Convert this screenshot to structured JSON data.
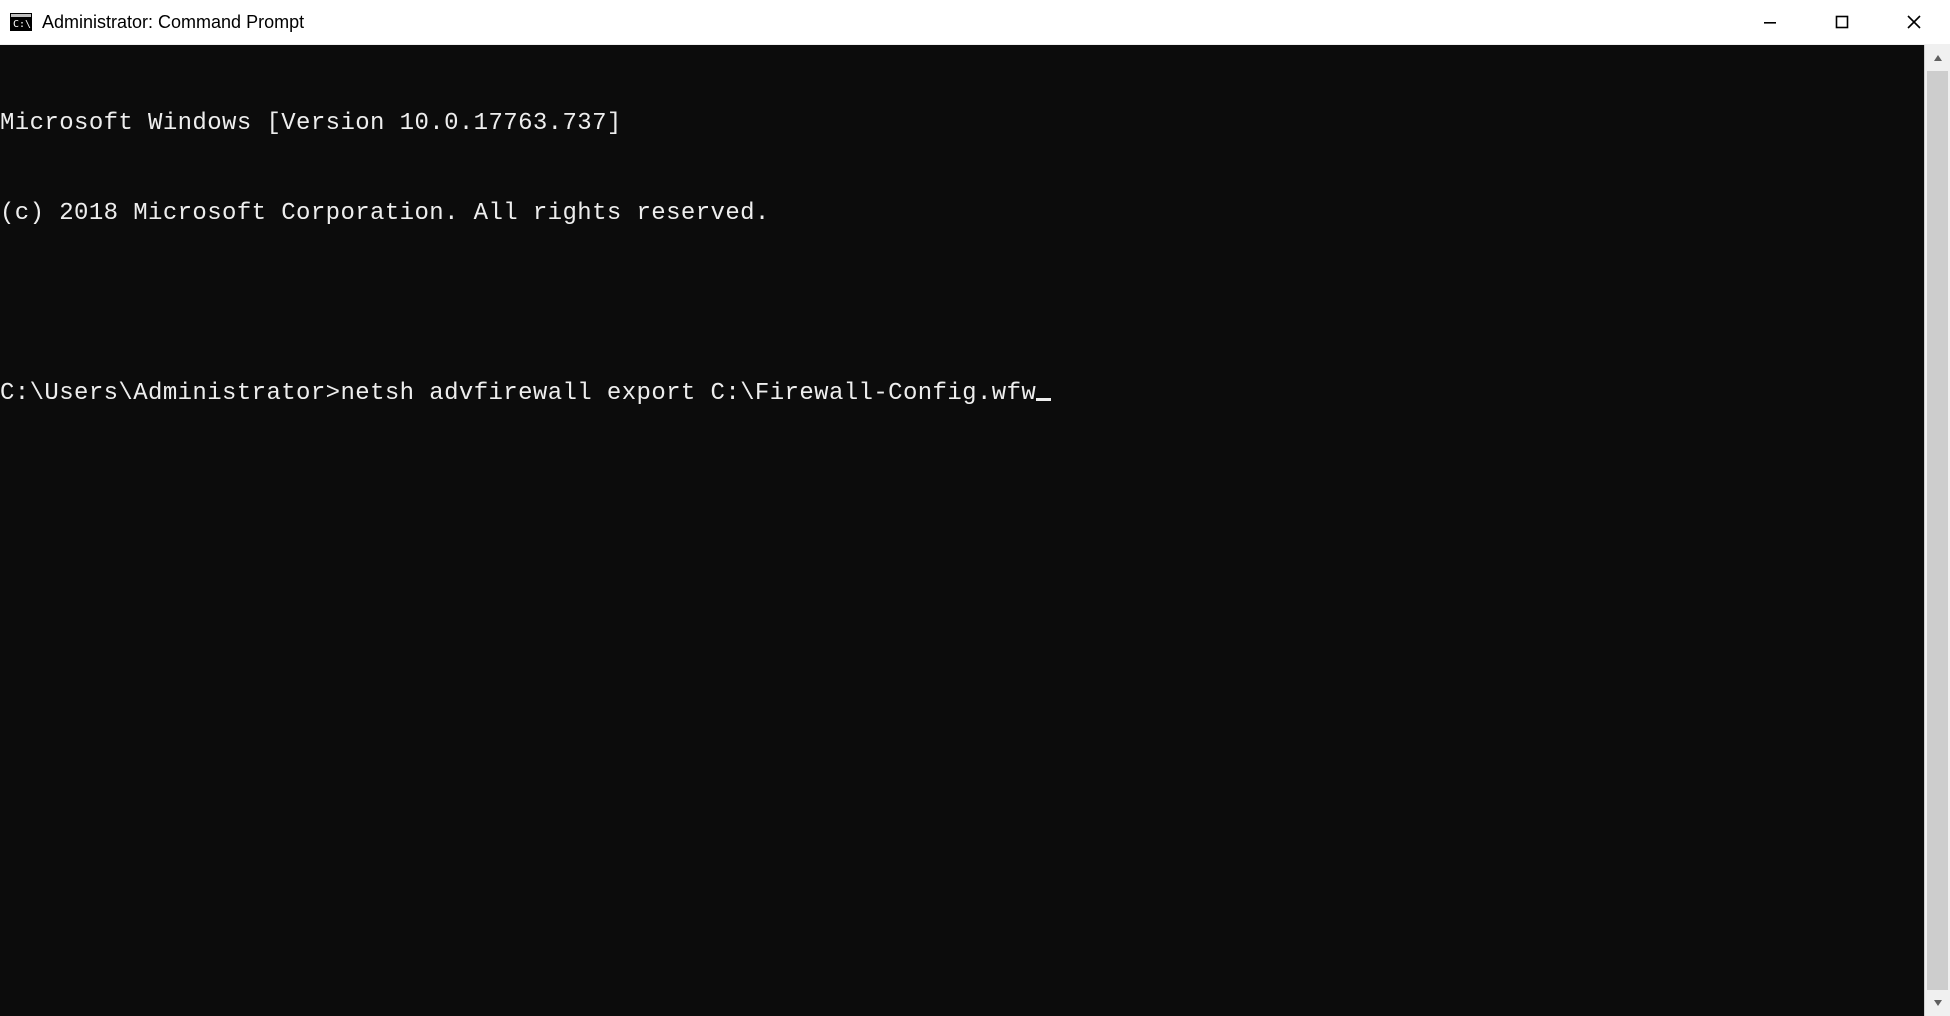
{
  "window": {
    "title": "Administrator: Command Prompt",
    "icon": "cmd-icon"
  },
  "terminal": {
    "lines": [
      "Microsoft Windows [Version 10.0.17763.737]",
      "(c) 2018 Microsoft Corporation. All rights reserved.",
      ""
    ],
    "prompt": "C:\\Users\\Administrator>",
    "command": "netsh advfirewall export C:\\Firewall-Config.wfw"
  }
}
